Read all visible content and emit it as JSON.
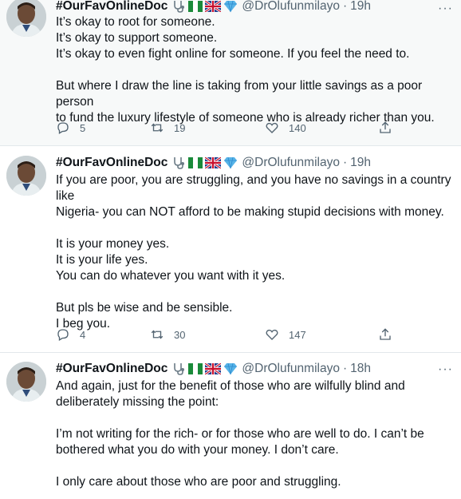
{
  "tweets": [
    {
      "name": "#OurFavOnlineDoc",
      "handle": "@DrOlufunmilayo",
      "time": "19h",
      "lines": [
        "It’s okay to root for someone.",
        "It’s okay to support someone.",
        "It’s okay to even fight online for someone. If you feel the need to.",
        "",
        "But where I draw the line is taking from your little savings as a poor person",
        "to fund the luxury lifestyle of someone who is already richer than you."
      ],
      "replies": "5",
      "retweets": "19",
      "likes": "140"
    },
    {
      "name": "#OurFavOnlineDoc",
      "handle": "@DrOlufunmilayo",
      "time": "19h",
      "lines": [
        "If you are poor, you are struggling, and you have no savings in a country like",
        "Nigeria- you can NOT afford to be making stupid decisions with money.",
        "",
        "It is your money yes.",
        "It is your life yes.",
        "You can do whatever you want with it yes.",
        "",
        "But pls be wise and be sensible.",
        "I beg you."
      ],
      "replies": "4",
      "retweets": "30",
      "likes": "147"
    },
    {
      "name": "#OurFavOnlineDoc",
      "handle": "@DrOlufunmilayo",
      "time": "18h",
      "lines": [
        "And again, just for the benefit of those who are wilfully blind and",
        "deliberately missing the point:",
        "",
        "I’m not writing for the rich- or for those who are well to do. I can’t be",
        "bothered what you do with your money. I don’t care.",
        "",
        "I only care about those who are poor and struggling."
      ]
    }
  ],
  "separator": "·",
  "menu_glyph": "···"
}
